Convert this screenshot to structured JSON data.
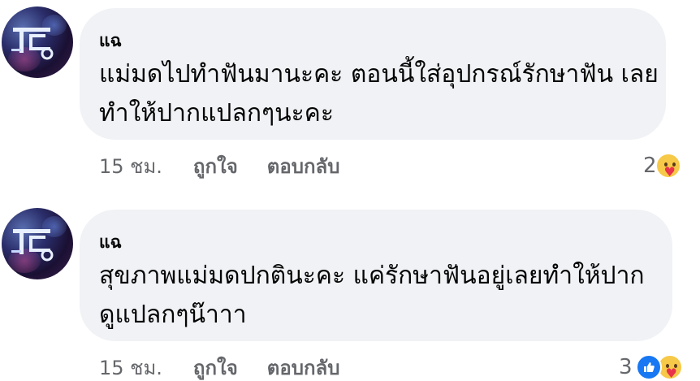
{
  "comments": [
    {
      "author": "แฉ",
      "text": "แม่มดไปทำฟันมานะคะ ตอนนี้ใส่อุปกรณ์รักษาฟัน เลยทำให้ปากแปลกๆนะคะ",
      "time": "15 ชม.",
      "like_label": "ถูกใจ",
      "reply_label": "ตอบกลับ",
      "reaction_count": "2",
      "reactions": [
        "care-icon"
      ]
    },
    {
      "author": "แฉ",
      "text": "สุขภาพแม่มดปกตินะคะ แค่รักษาฟันอยู่เลยทำให้ปากดูแปลกๆน๊าาา",
      "time": "15 ชม.",
      "like_label": "ถูกใจ",
      "reply_label": "ตอบกลับ",
      "reaction_count": "3",
      "reactions": [
        "like-icon",
        "care-icon"
      ]
    }
  ],
  "colors": {
    "bubble": "#f0f2f5",
    "meta_text": "#65676b",
    "like_blue": "#1877f2",
    "care_yellow": "#f7c948"
  }
}
